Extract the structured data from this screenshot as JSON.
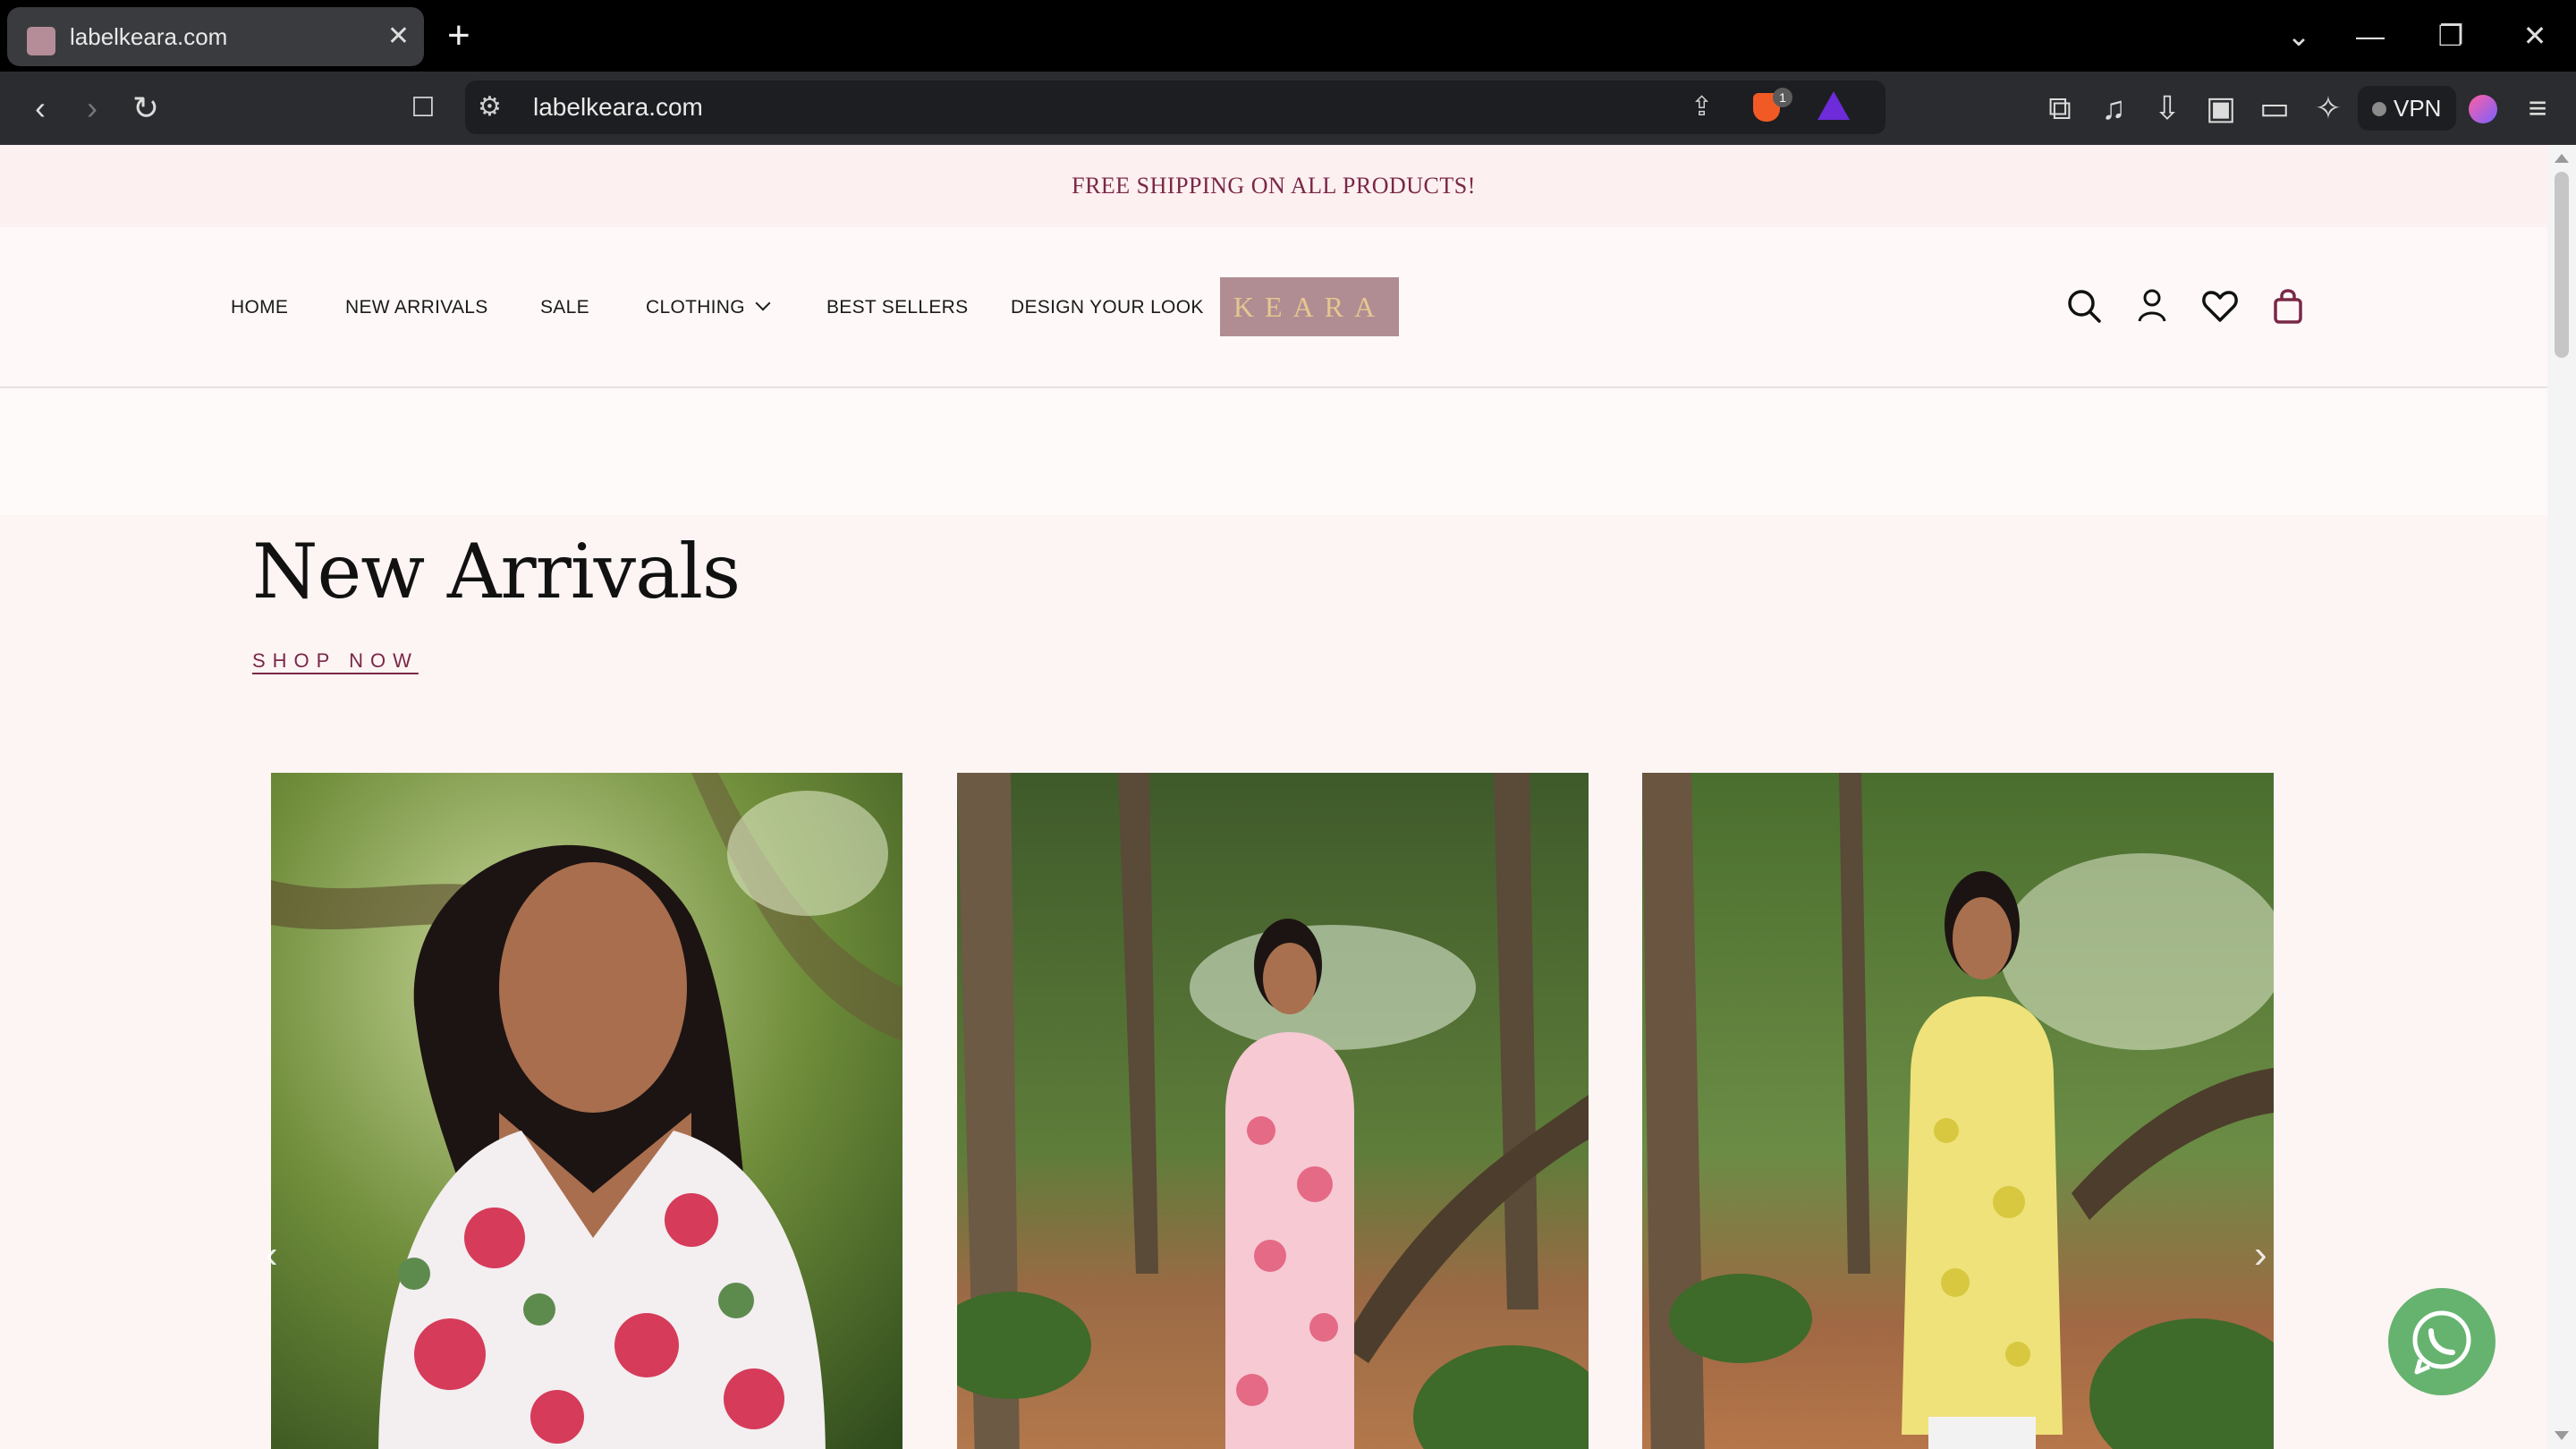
{
  "browser": {
    "tab_title": "labelkeara.com",
    "tab_close": "✕",
    "new_tab": "+",
    "url": "labelkeara.com",
    "shield_count": "1",
    "vpn_label": "VPN"
  },
  "site": {
    "announcement": "FREE SHIPPING ON ALL PRODUCTS!",
    "menu": {
      "home": "HOME",
      "new_arrivals": "NEW ARRIVALS",
      "sale": "SALE",
      "clothing": "CLOTHING",
      "best_sellers": "BEST SELLERS",
      "design_your_look": "DESIGN YOUR LOOK"
    },
    "logo_text": "KEARA",
    "section_title": "New Arrivals",
    "shop_now": "SHOP NOW",
    "products": [
      {
        "dress_color": "#f3eef0",
        "accent": "#d63b5a"
      },
      {
        "dress_color": "#f6c9d3",
        "accent": "#e56a85"
      },
      {
        "dress_color": "#efe27a",
        "accent": "#d8c840"
      }
    ]
  },
  "colors": {
    "announcement_text": "#7a2747",
    "logo_bg": "#b08d92",
    "logo_text": "#e6c690",
    "whatsapp": "#66b36f"
  }
}
